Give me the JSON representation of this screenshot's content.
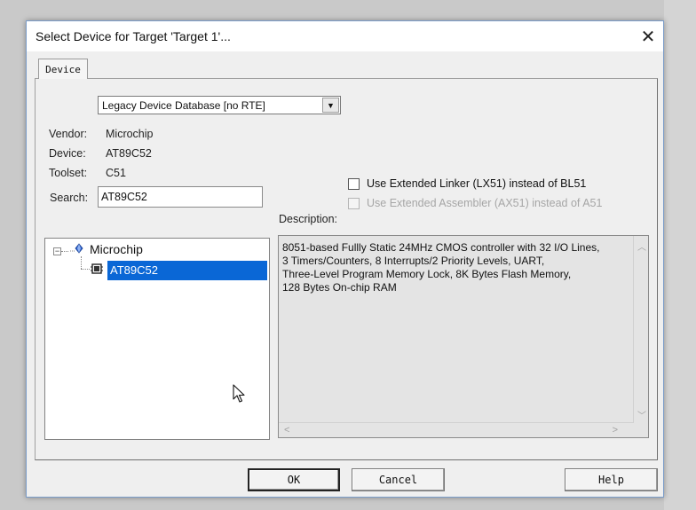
{
  "dialog": {
    "title": "Select Device for Target 'Target 1'...",
    "close_glyph": "✕"
  },
  "tabs": [
    {
      "label": "Device",
      "active": true
    }
  ],
  "database_select": {
    "value": "Legacy Device Database [no RTE]",
    "arrow_icon": "dropdown-arrow-icon"
  },
  "info": {
    "vendor_label": "Vendor:",
    "vendor_value": "Microchip",
    "device_label": "Device:",
    "device_value": "AT89C52",
    "toolset_label": "Toolset:",
    "toolset_value": "C51",
    "search_label": "Search:",
    "search_value": "AT89C52"
  },
  "options": {
    "extended_linker": {
      "label": "Use Extended Linker (LX51) instead of BL51",
      "checked": false,
      "enabled": true
    },
    "extended_assembler": {
      "label": "Use Extended Assembler (AX51) instead of A51",
      "checked": false,
      "enabled": false
    }
  },
  "tree": {
    "vendor_node": {
      "toggle": "⊟",
      "label": "Microchip",
      "icon": "vendor-diamond-icon"
    },
    "device_node": {
      "label": "AT89C52",
      "icon": "chip-icon",
      "selected": true
    }
  },
  "description": {
    "label": "Description:",
    "text": "8051-based Fullly Static 24MHz CMOS controller with 32  I/O Lines,\n3 Timers/Counters, 8 Interrupts/2 Priority Levels, UART,\nThree-Level Program Memory Lock, 8K Bytes Flash Memory,\n128 Bytes On-chip RAM"
  },
  "buttons": {
    "ok": "OK",
    "cancel": "Cancel",
    "help": "Help"
  },
  "colors": {
    "selection": "#0a67d6",
    "dialog_border": "#7a9cc9",
    "dialog_bg": "#efefef"
  }
}
